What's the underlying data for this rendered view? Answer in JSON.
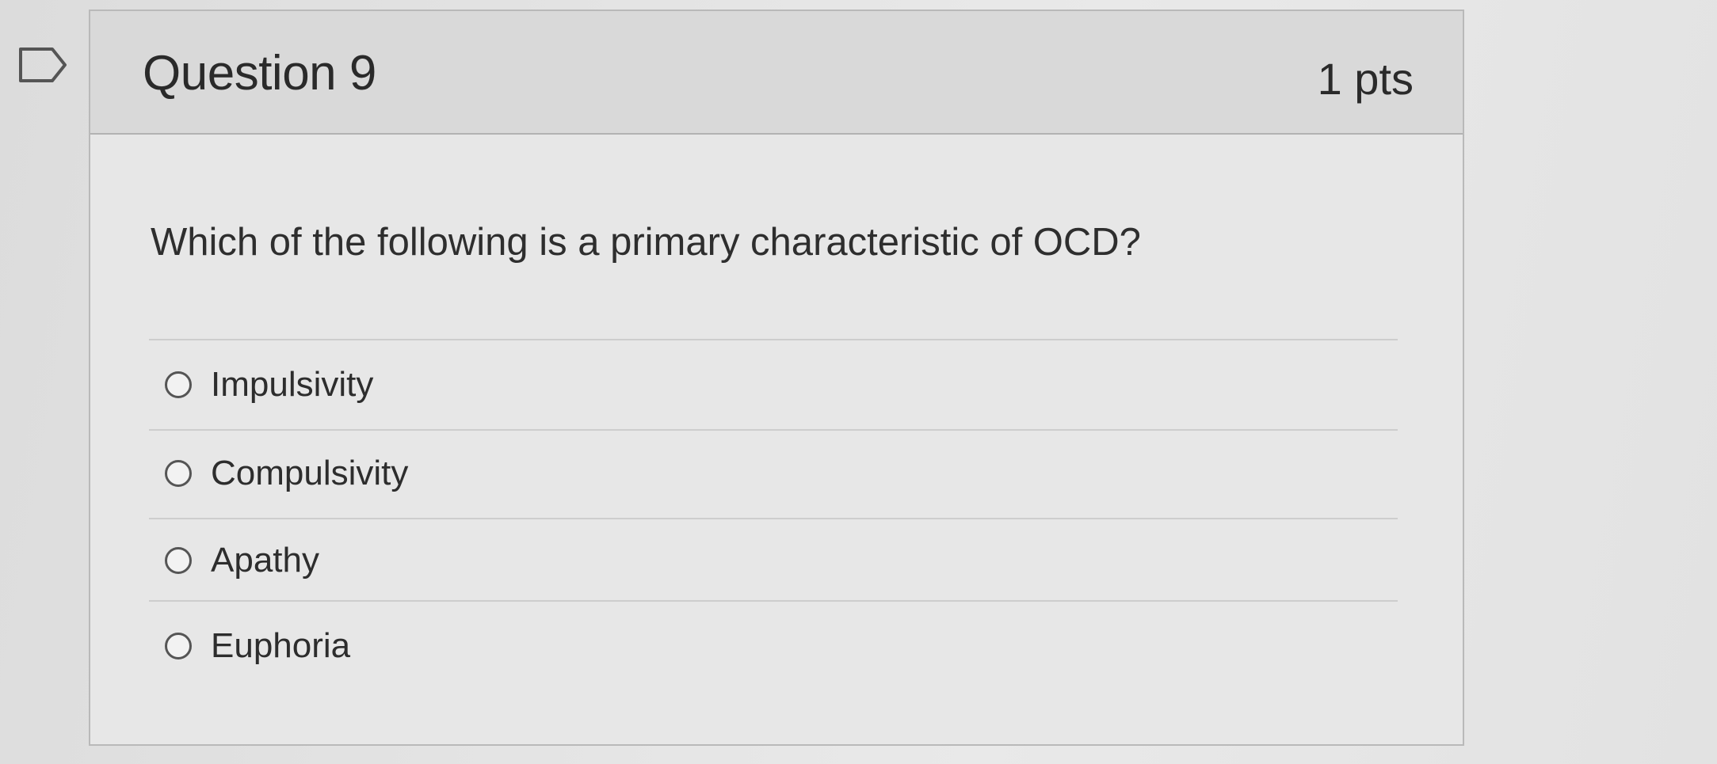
{
  "question": {
    "title": "Question 9",
    "points": "1 pts",
    "prompt": "Which of the following is a primary characteristic of OCD?",
    "flag_icon": "flag-outline-icon",
    "answers": [
      {
        "label": "Impulsivity",
        "selected": false
      },
      {
        "label": "Compulsivity",
        "selected": false
      },
      {
        "label": "Apathy",
        "selected": false
      },
      {
        "label": "Euphoria",
        "selected": false
      }
    ]
  },
  "colors": {
    "header_bg": "#d9d9d9",
    "card_bg": "#e7e7e7",
    "border": "#b9b9b9",
    "text": "#2d2d2d"
  }
}
